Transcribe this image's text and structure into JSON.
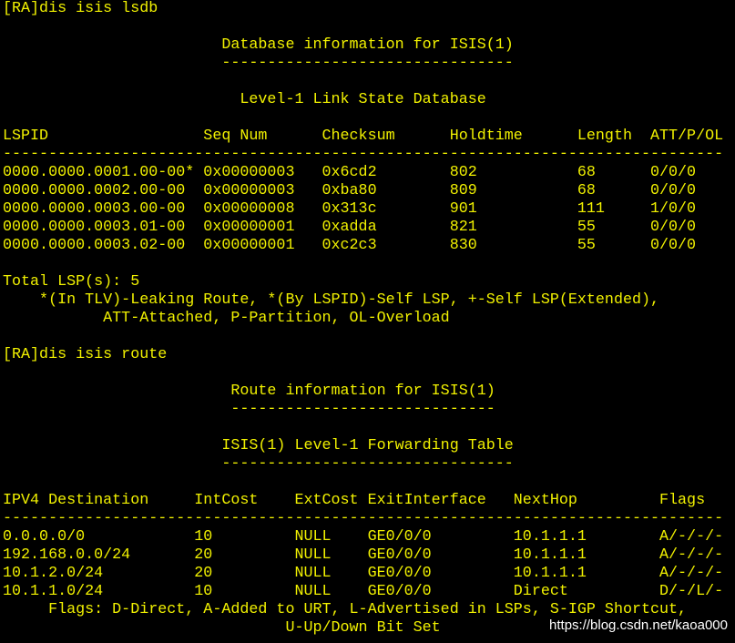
{
  "colors": {
    "background": "#000000",
    "terminal_text": "#f1f100",
    "watermark_text": "#ffffff"
  },
  "terminal": {
    "lines": [
      "[RA]dis isis lsdb",
      "",
      "                        Database information for ISIS(1)",
      "                        --------------------------------",
      "",
      "                          Level-1 Link State Database",
      "",
      "LSPID                 Seq Num      Checksum      Holdtime      Length  ATT/P/OL",
      "-------------------------------------------------------------------------------",
      "0000.0000.0001.00-00* 0x00000003   0x6cd2        802           68      0/0/0",
      "0000.0000.0002.00-00  0x00000003   0xba80        809           68      0/0/0",
      "0000.0000.0003.00-00  0x00000008   0x313c        901           111     1/0/0",
      "0000.0000.0003.01-00  0x00000001   0xadda        821           55      0/0/0",
      "0000.0000.0003.02-00  0x00000001   0xc2c3        830           55      0/0/0",
      "",
      "Total LSP(s): 5",
      "    *(In TLV)-Leaking Route, *(By LSPID)-Self LSP, +-Self LSP(Extended),",
      "           ATT-Attached, P-Partition, OL-Overload",
      "",
      "[RA]dis isis route",
      "",
      "                         Route information for ISIS(1)",
      "                         -----------------------------",
      "",
      "                        ISIS(1) Level-1 Forwarding Table",
      "                        --------------------------------",
      "",
      "IPV4 Destination     IntCost    ExtCost ExitInterface   NextHop         Flags",
      "-------------------------------------------------------------------------------",
      "0.0.0.0/0            10         NULL    GE0/0/0         10.1.1.1        A/-/-/-",
      "192.168.0.0/24       20         NULL    GE0/0/0         10.1.1.1        A/-/-/-",
      "10.1.2.0/24          20         NULL    GE0/0/0         10.1.1.1        A/-/-/-",
      "10.1.1.0/24          10         NULL    GE0/0/0         Direct          D/-/L/-",
      "     Flags: D-Direct, A-Added to URT, L-Advertised in LSPs, S-IGP Shortcut,",
      "                               U-Up/Down Bit Set"
    ]
  },
  "watermark": {
    "text": "https://blog.csdn.net/kaoa000"
  }
}
